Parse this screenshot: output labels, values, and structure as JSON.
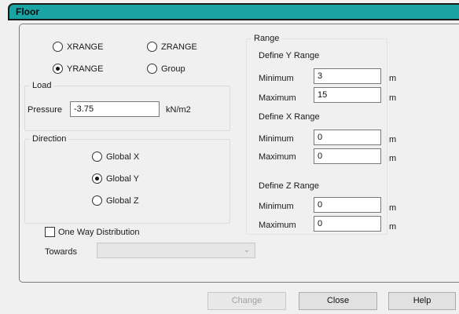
{
  "window": {
    "title": "Floor"
  },
  "range_type": {
    "options": [
      {
        "label": "XRANGE",
        "checked": false
      },
      {
        "label": "ZRANGE",
        "checked": false
      },
      {
        "label": "YRANGE",
        "checked": true
      },
      {
        "label": "Group",
        "checked": false
      }
    ]
  },
  "load": {
    "legend": "Load",
    "pressure_label": "Pressure",
    "pressure_value": "-3.75",
    "unit": "kN/m2"
  },
  "direction": {
    "legend": "Direction",
    "options": [
      {
        "label": "Global X",
        "checked": false
      },
      {
        "label": "Global Y",
        "checked": true
      },
      {
        "label": "Global Z",
        "checked": false
      }
    ]
  },
  "one_way": {
    "label": "One Way Distribution",
    "checked": false
  },
  "towards": {
    "label": "Towards",
    "value": ""
  },
  "range": {
    "legend": "Range",
    "y": {
      "title": "Define Y Range",
      "min_label": "Minimum",
      "min": "3",
      "max_label": "Maximum",
      "max": "15",
      "unit": "m"
    },
    "x": {
      "title": "Define X Range",
      "min_label": "Minimum",
      "min": "0",
      "max_label": "Maximum",
      "max": "0",
      "unit": "m"
    },
    "z": {
      "title": "Define Z Range",
      "min_label": "Minimum",
      "min": "0",
      "max_label": "Maximum",
      "max": "0",
      "unit": "m"
    }
  },
  "buttons": {
    "change": "Change",
    "close": "Close",
    "help": "Help"
  }
}
